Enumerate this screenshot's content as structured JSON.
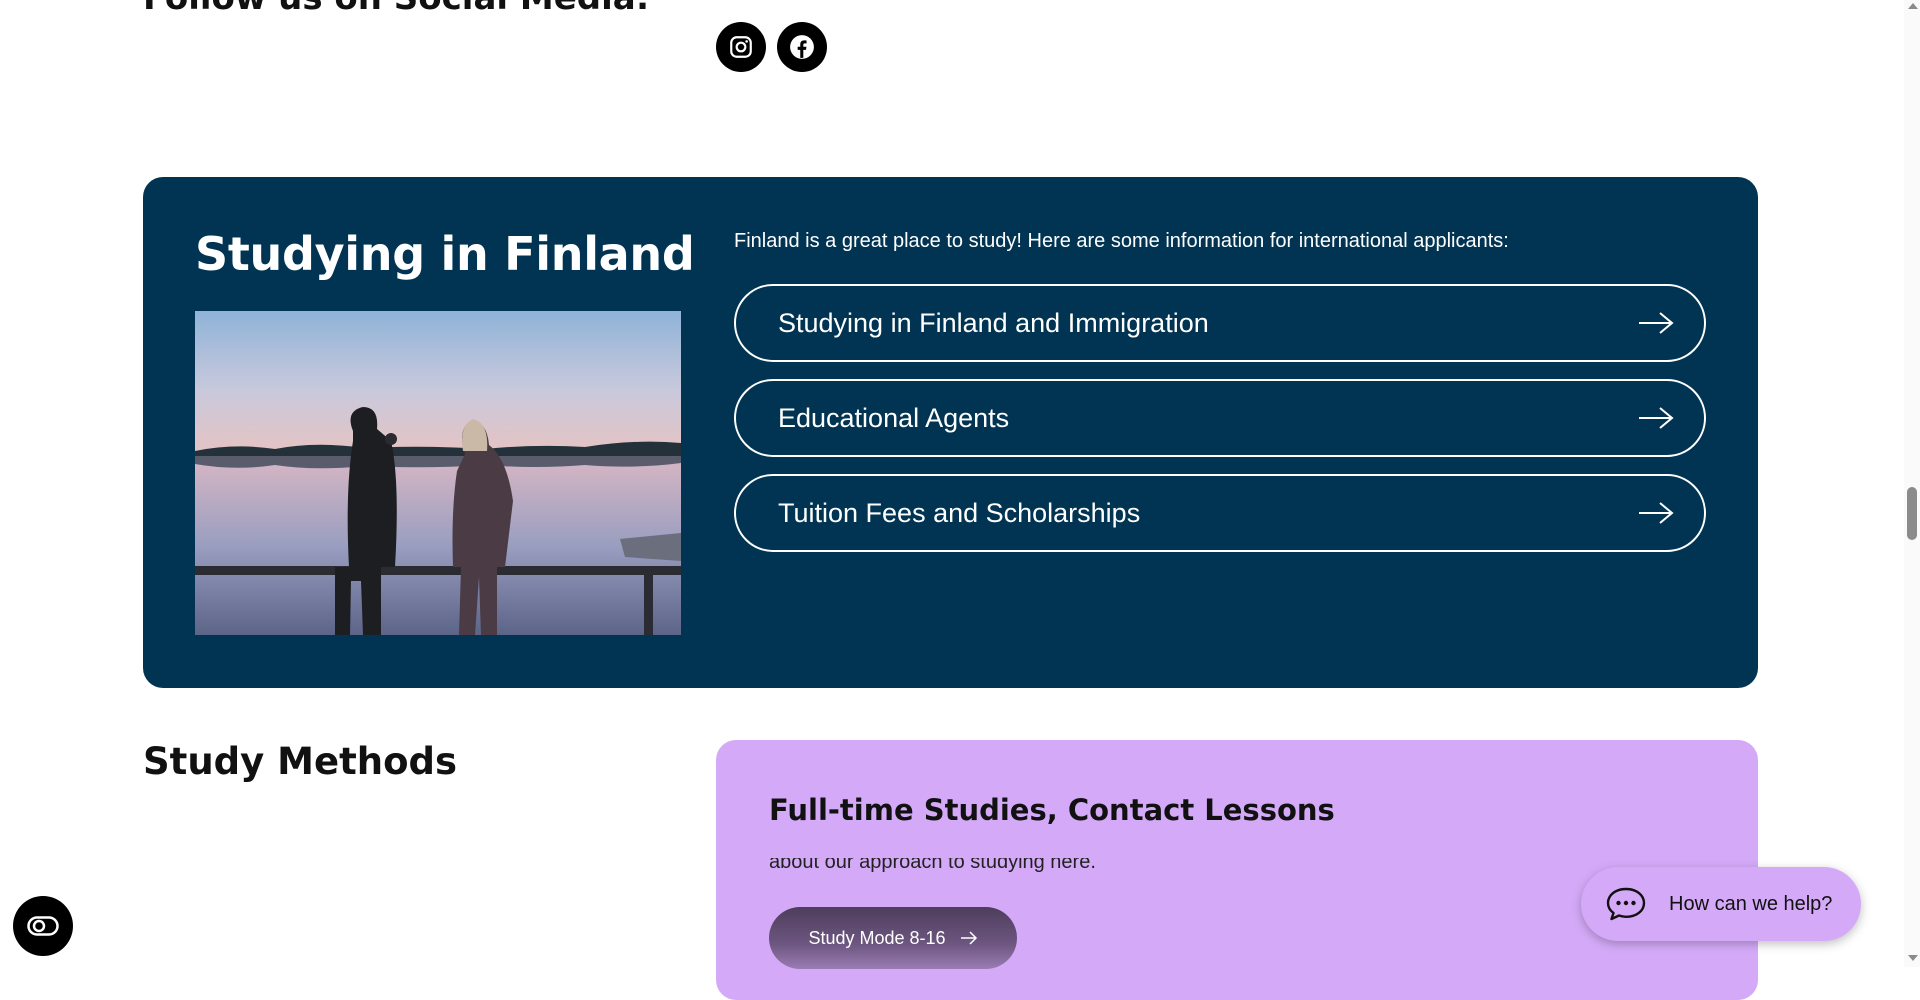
{
  "social": {
    "heading": "Follow us on Social Media:",
    "icons": [
      "instagram-icon",
      "facebook-icon"
    ]
  },
  "finland": {
    "title": "Studying in Finland",
    "intro": "Finland is a great place to study! Here are some information for international applicants:",
    "links": [
      {
        "label": "Studying in Finland and Immigration"
      },
      {
        "label": "Educational Agents"
      },
      {
        "label": "Tuition Fees and Scholarships"
      }
    ],
    "colors": {
      "background": "#003452",
      "text": "#ffffff"
    }
  },
  "methods": {
    "title": "Study Methods",
    "card": {
      "title": "Full-time Studies, Contact Lessons",
      "text": "about our approach to studying here.",
      "button_label": "Study Mode 8-16"
    },
    "colors": {
      "card": "#d4aaf8"
    }
  },
  "chat": {
    "label": "How can we help?"
  },
  "accessibility": {
    "icon": "accessibility-toggle-icon"
  }
}
